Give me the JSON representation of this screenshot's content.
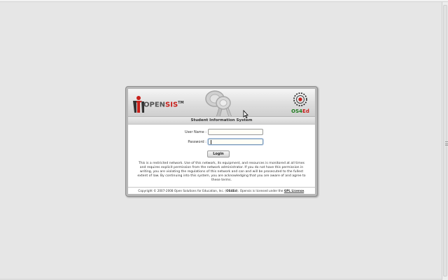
{
  "header": {
    "logo_prefix": "OPEN",
    "logo_suffix": "SIS",
    "logo_tm": "TM",
    "partner_logo": "OS4Ed",
    "subtitle": "Student Information System"
  },
  "form": {
    "username_label": "User Name :",
    "username_value": "",
    "password_label": "Password :",
    "password_value": "",
    "login_label": "Login"
  },
  "notice": "This is a restricted network. Use of this network, its equipment, and resources is monitored at all times and requires explicit permission from the network administrator. If you do not have this permission in writing, you are violating the regulations of this network and can and will be prosecuted to the fullest extent of law. By continuing into this system, you are acknowledging that you are aware of and agree to these terms.",
  "footer": {
    "prefix": "Copyright © 2007-2008 Open Solutions for Education, Inc. (",
    "brand": "OS4Ed",
    "middle": "). Opensis is licensed under the ",
    "license": "GPL License",
    "suffix": "."
  },
  "colors": {
    "accent_red": "#c8201b",
    "accent_green": "#1d7a1d",
    "background": "#e6e6e6"
  },
  "icons": {
    "logo": "opensis-logo-icon",
    "keys": "keys-icon",
    "partner": "os4ed-logo-icon",
    "cursor": "mouse-pointer-icon"
  }
}
